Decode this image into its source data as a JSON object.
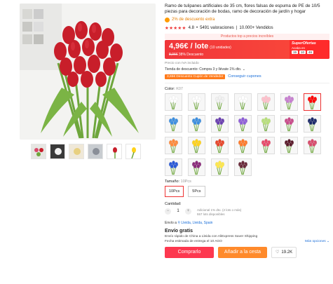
{
  "product": {
    "title": "Ramo de tulipanes artificiales de 35 cm, flores falsas de espuma de PE de 10/5 piezas para decoración de bodas, ramo de decoración de jardín y hogar",
    "extra_discount": "2% de descuento extra",
    "rating": "4.8",
    "ratings_count": "5491 valoraciones",
    "sold": "10.000+ Vendidos"
  },
  "banner": {
    "top_products": "Productos top a precios increíbles"
  },
  "price": {
    "current": "4,96€ / lote",
    "lote_units": "(10 unidades)",
    "old": "8,06€",
    "discount": "38% Descuento",
    "super_title": "SuperOfertas",
    "super_sub": "Acaba en",
    "timer": [
      "15",
      "10",
      "46"
    ],
    "tax_note": "Precio con IVA incluido"
  },
  "promo": {
    "store_discount": "Tienda de descuento: Compra 3 y llévate 1% dto. ⌄",
    "coupon_badge": "3,65€ Descuento Cupón de Vendedor",
    "coupon_link": "Conseguir cupones"
  },
  "color": {
    "label": "Color:",
    "value": "K07",
    "selected_index": 6,
    "swatches": [
      "white",
      "white",
      "#f2f2f2",
      "white",
      "pink",
      "#c77fd0",
      "red",
      "#3d8fe0",
      "#3d8fe0",
      "#6a3fb0",
      "#8f5fd8",
      "#b8e07a",
      "#c94a8a",
      "#1c2a6a",
      "#ff8a3a",
      "#ffd21a",
      "#e8462a",
      "#ff7a2a",
      "#e84a6a",
      "#5a1a2a",
      "#d84a6a",
      "#2a5ad8",
      "#8a2a7a",
      "#ffe84a",
      "#6a2a3a"
    ]
  },
  "size": {
    "label": "Tamaño:",
    "value": "10Pcs",
    "options": [
      "10Pcs",
      "5Pcs"
    ]
  },
  "quantity": {
    "label": "Cantidad:",
    "value": "1",
    "info1": "Adicional 1% dto. (2 lots o más)",
    "info2": "557 lots disponibles"
  },
  "shipping": {
    "to_label": "Envío a",
    "location": "Lleida, Lleida, Spain",
    "free": "Envío gratis",
    "line1": "Envío rápido de China a Lleida con AliExpress Saver Shipping",
    "line2": "Fecha estimada de entrega el 10 AGO",
    "more": "Más opciones ⌄"
  },
  "actions": {
    "buy": "Comprarlo",
    "cart": "Añadir a la cesta",
    "wish_count": "19.2K"
  },
  "colors": {
    "accent": "#f0363a",
    "orange": "#ff8a2b",
    "link": "#1a6ed8"
  }
}
